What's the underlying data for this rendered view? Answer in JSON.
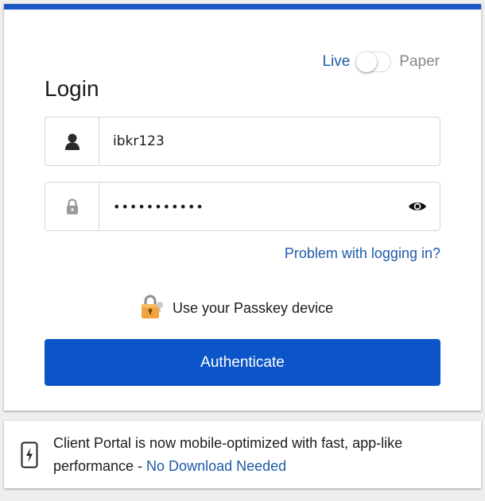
{
  "mode": {
    "live_label": "Live",
    "paper_label": "Paper",
    "selected": "Live"
  },
  "login": {
    "title": "Login",
    "username_value": "ibkr123",
    "password_masked": "•••••••••••",
    "problem_link": "Problem with logging in?",
    "passkey_label": "Use your Passkey device",
    "authenticate_label": "Authenticate"
  },
  "notice": {
    "text": "Client Portal is now mobile-optimized with fast, app-like performance - ",
    "link": "No Download Needed"
  },
  "icons": {
    "username": "user-icon",
    "password": "lock-icon",
    "reveal": "eye-icon",
    "passkey": "padlock-key-icon",
    "notice": "mobile-bolt-icon"
  },
  "colors": {
    "accent": "#1a56c4",
    "button": "#0b55c9",
    "link": "#1f5ba8"
  }
}
